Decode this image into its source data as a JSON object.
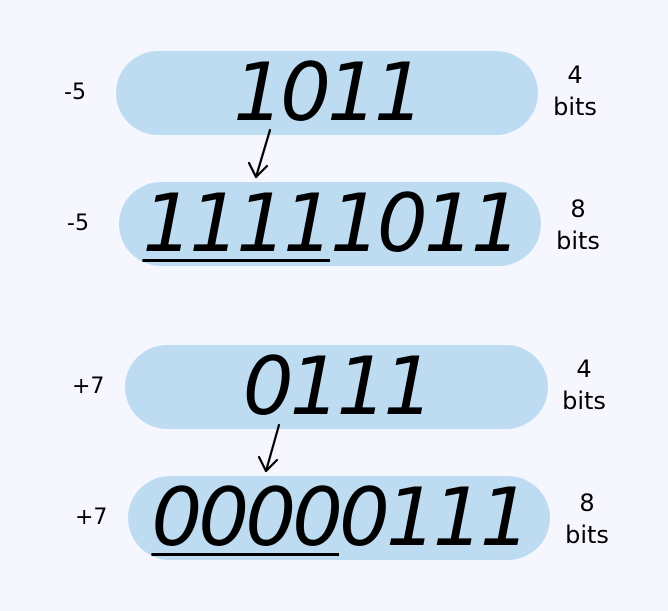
{
  "rows": [
    {
      "sign": "-5",
      "ext": "",
      "bits": "1011",
      "width_num": "4",
      "width_unit": "bits"
    },
    {
      "sign": "-5",
      "ext": "1111",
      "bits": "1011",
      "width_num": "8",
      "width_unit": "bits"
    },
    {
      "sign": "+7",
      "ext": "",
      "bits": "0111",
      "width_num": "4",
      "width_unit": "bits"
    },
    {
      "sign": "+7",
      "ext": "0000",
      "bits": "0111",
      "width_num": "8",
      "width_unit": "bits"
    }
  ],
  "colors": {
    "background": "#f6f6fe",
    "pill": "#bddcf2",
    "ink": "#000000"
  }
}
